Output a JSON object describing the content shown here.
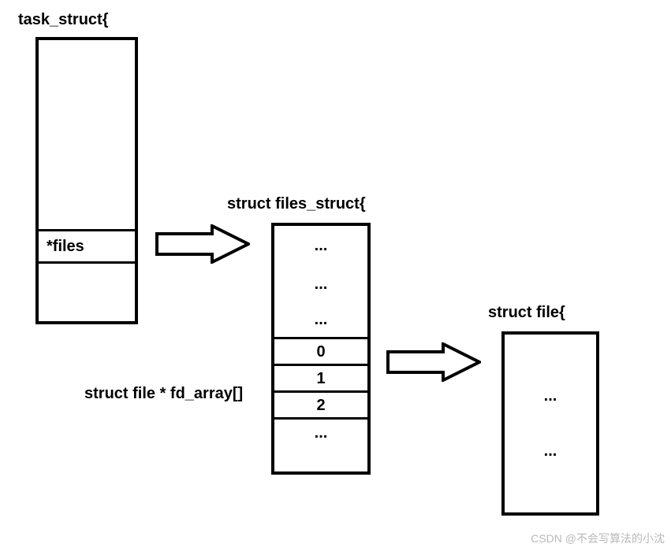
{
  "labels": {
    "task_struct": "task_struct{",
    "files_struct": "struct files_struct{",
    "fd_array": "struct file * fd_array[]",
    "struct_file": "struct file{",
    "files_ptr": "*files"
  },
  "task_struct_box": {
    "ellipsis_rows": []
  },
  "files_struct_box": {
    "top_ellipsis": [
      "...",
      "...",
      "..."
    ],
    "fd_rows": [
      "0",
      "1",
      "2",
      "..."
    ]
  },
  "file_box": {
    "rows": [
      "...",
      "..."
    ]
  },
  "watermark": "CSDN @不会写算法的小沈"
}
